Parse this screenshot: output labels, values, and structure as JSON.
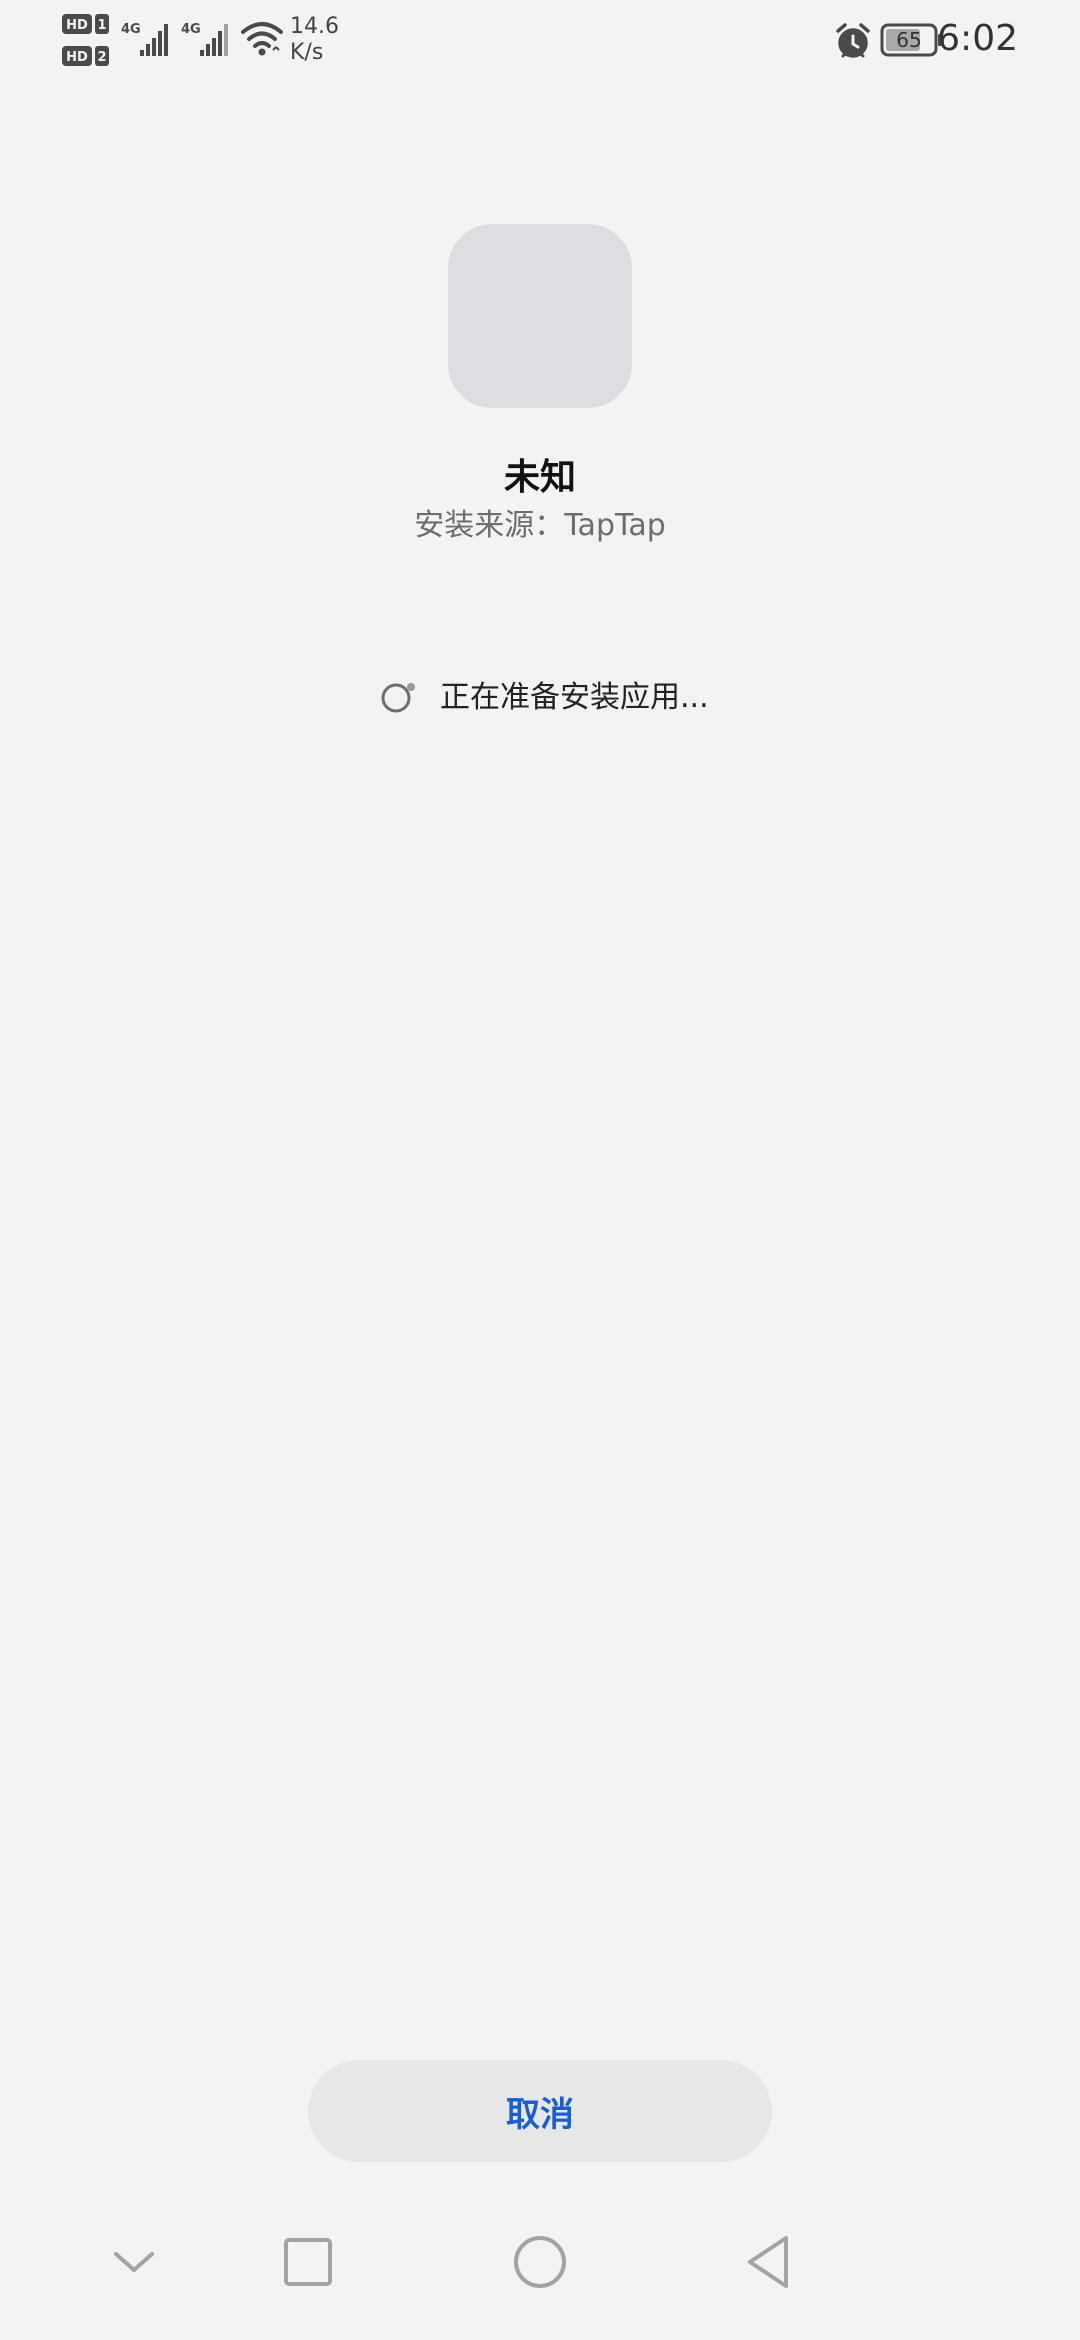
{
  "status_bar": {
    "sim1_label": "HD 1",
    "sim2_label": "HD 2",
    "network1": "4G",
    "network2": "4G",
    "speed_value": "14.6",
    "speed_unit": "K/s",
    "battery_level": "65",
    "time": "6:02",
    "icons": [
      "hd-sim-icon",
      "signal-icon",
      "wifi-icon",
      "alarm-icon",
      "battery-icon"
    ]
  },
  "install": {
    "app_name": "未知",
    "source_text": "安装来源：TapTap",
    "progress_text": "正在准备安装应用..."
  },
  "actions": {
    "cancel_label": "取消"
  },
  "nav_bar": {
    "icons": [
      "chevron-down-icon",
      "square-recents-icon",
      "circle-home-icon",
      "triangle-back-icon"
    ]
  },
  "colors": {
    "background": "#f1f3f5",
    "accent": "#1a5fd0",
    "button_bg": "#e6e7e9",
    "icon_placeholder": "#dcdde0"
  }
}
